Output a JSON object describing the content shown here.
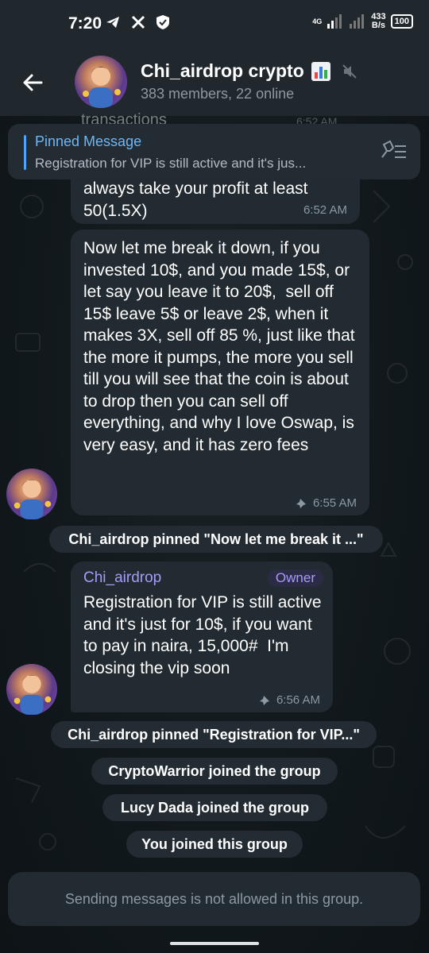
{
  "status_bar": {
    "time": "7:20",
    "network": "4G",
    "speed_value": "433",
    "speed_unit": "B/s",
    "battery": "100"
  },
  "header": {
    "title": "Chi_airdrop crypto",
    "subtitle": "383 members, 22 online"
  },
  "pinned": {
    "label": "Pinned Message",
    "text": "Registration for VIP is still active and it's jus..."
  },
  "ghost": {
    "text": "transactions",
    "time": "6:52 AM"
  },
  "messages": [
    {
      "text": "always take your profit at least\n50(1.5X)",
      "time": "6:52 AM"
    },
    {
      "text": "Now let me break it down, if you invested 10$, and you made 15$, or let say you leave it to 20$,  sell off 15$ leave 5$ or leave 2$, when it makes 3X, sell off 85 %, just like that the more it pumps, the more you sell till you will see that the coin is about to drop then you can sell off everything, and why I love Oswap, is very easy, and it has zero fees",
      "time": "6:55 AM"
    },
    {
      "sender": "Chi_airdrop",
      "badge": "Owner",
      "text": "Registration for VIP is still active and it's just for 10$, if you want to pay in naira, 15,000#  I'm closing the vip soon",
      "time": "6:56 AM"
    }
  ],
  "service_messages": [
    "Chi_airdrop pinned \"Now let me break it ...\"",
    "Chi_airdrop pinned \"Registration for VIP...\"",
    "CryptoWarrior joined the group",
    "Lucy Dada joined the group",
    "You joined this group"
  ],
  "composer": {
    "notice": "Sending messages is not allowed in this group."
  },
  "colors": {
    "accent": "#6db7f9",
    "owner": "#a69cf7",
    "bubble": "#222b31",
    "header": "#20272d"
  }
}
